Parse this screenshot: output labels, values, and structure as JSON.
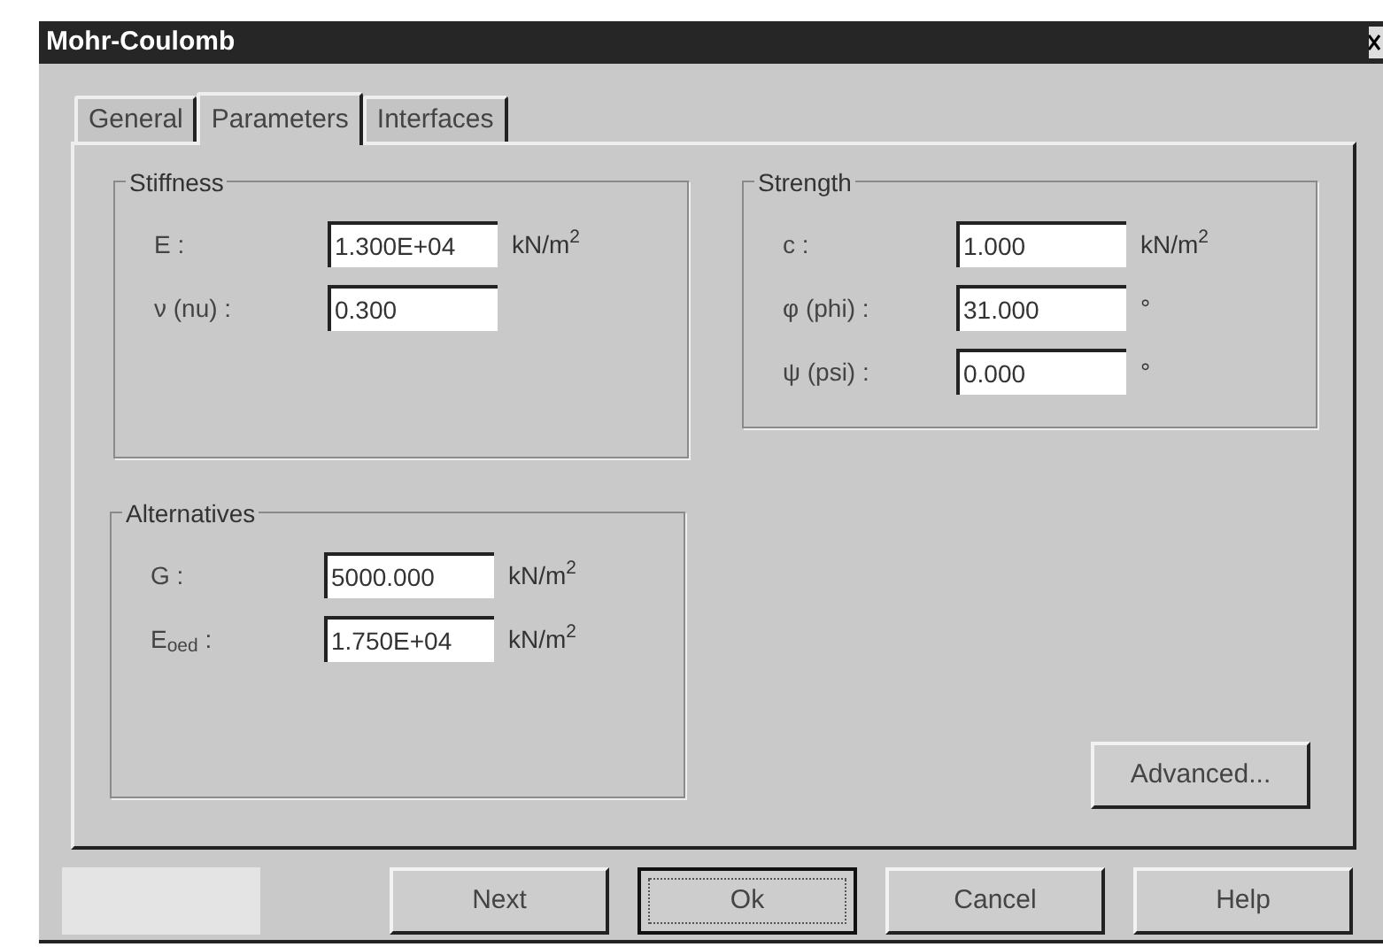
{
  "window": {
    "title": "Mohr-Coulomb"
  },
  "tabs": [
    {
      "label": "General",
      "selected": false
    },
    {
      "label": "Parameters",
      "selected": true
    },
    {
      "label": "Interfaces",
      "selected": false
    }
  ],
  "groups": [
    {
      "title": "Stiffness",
      "fields": [
        {
          "label": "E :",
          "value": "1.300E+04",
          "unit": "kN/m$^{2}$"
        },
        {
          "label": "ν (nu) :",
          "value": "0.300"
        }
      ]
    },
    {
      "title": "Strength",
      "fields": [
        {
          "label": "c :",
          "value": "1.000",
          "unit": "kN/m$^{2}$"
        },
        {
          "label": "φ (phi) :",
          "value": "31.000",
          "unit": "°"
        },
        {
          "label": "ψ (psi) :",
          "value": "0.000",
          "unit": "°"
        }
      ]
    },
    {
      "title": "Alternatives",
      "fields": [
        {
          "label": "G :",
          "value": "5000.000",
          "unit": "kN/m$^{2}$"
        },
        {
          "label": "E$_{oed}$ :",
          "value": "1.750E+04",
          "unit": "kN/m$^{2}$"
        }
      ]
    }
  ],
  "advanced_button": "Advanced...",
  "buttons": [
    {
      "label": "Next",
      "default": false
    },
    {
      "label": "Ok",
      "default": true
    },
    {
      "label": "Cancel",
      "default": false
    },
    {
      "label": "Help",
      "default": false
    }
  ]
}
